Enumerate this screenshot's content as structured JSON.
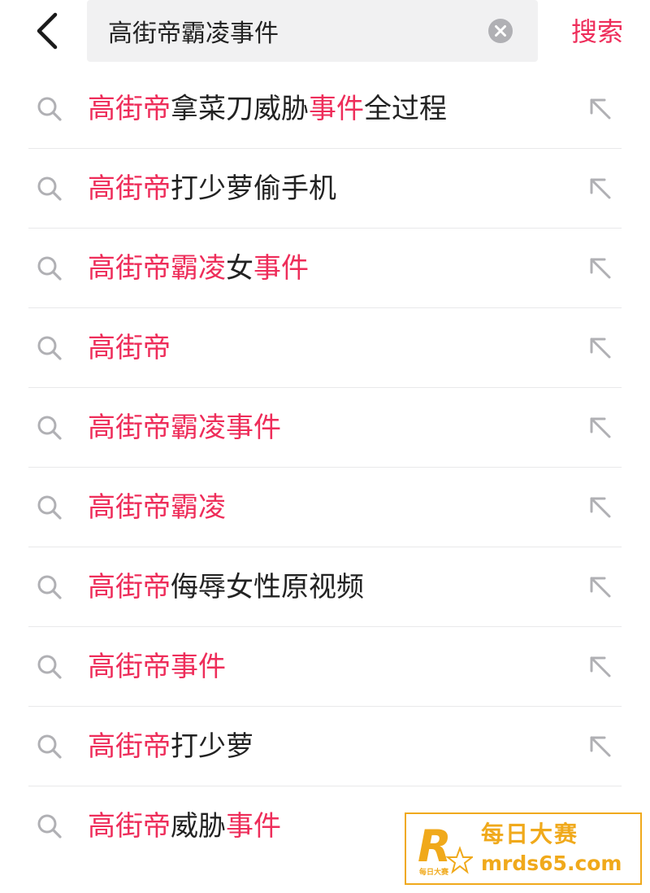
{
  "header": {
    "search_value": "高街帝霸凌事件",
    "search_button_label": "搜索"
  },
  "suggestions": [
    {
      "parts": [
        {
          "t": "高街帝",
          "hl": true
        },
        {
          "t": "拿菜刀威胁",
          "hl": false
        },
        {
          "t": "事件",
          "hl": true
        },
        {
          "t": "全过程",
          "hl": false
        }
      ]
    },
    {
      "parts": [
        {
          "t": "高街帝",
          "hl": true
        },
        {
          "t": "打少萝偷手机",
          "hl": false
        }
      ]
    },
    {
      "parts": [
        {
          "t": "高街帝霸凌",
          "hl": true
        },
        {
          "t": "女",
          "hl": false
        },
        {
          "t": "事件",
          "hl": true
        }
      ]
    },
    {
      "parts": [
        {
          "t": "高街帝",
          "hl": true
        }
      ]
    },
    {
      "parts": [
        {
          "t": "高街帝霸凌事件",
          "hl": true
        }
      ]
    },
    {
      "parts": [
        {
          "t": "高街帝霸凌",
          "hl": true
        }
      ]
    },
    {
      "parts": [
        {
          "t": "高街帝",
          "hl": true
        },
        {
          "t": "侮辱女性原视频",
          "hl": false
        }
      ]
    },
    {
      "parts": [
        {
          "t": "高街帝事件",
          "hl": true
        }
      ]
    },
    {
      "parts": [
        {
          "t": "高街帝",
          "hl": true
        },
        {
          "t": "打少萝",
          "hl": false
        }
      ]
    },
    {
      "parts": [
        {
          "t": "高街帝",
          "hl": true
        },
        {
          "t": "威胁",
          "hl": false
        },
        {
          "t": "事件",
          "hl": true
        }
      ]
    }
  ],
  "icons": {
    "back": "chevron-left-icon",
    "clear": "clear-circle-icon",
    "search": "search-icon",
    "fill": "arrow-up-left-icon"
  },
  "colors": {
    "accent": "#ee2d5a",
    "text": "#222222",
    "icon": "#b0b0b4",
    "search_bg": "#f1f1f2",
    "watermark": "#f0a91b"
  },
  "watermark": {
    "logo_letter": "R",
    "logo_sub": "每日大赛",
    "title": "每日大赛",
    "url": "mrds65.com"
  }
}
